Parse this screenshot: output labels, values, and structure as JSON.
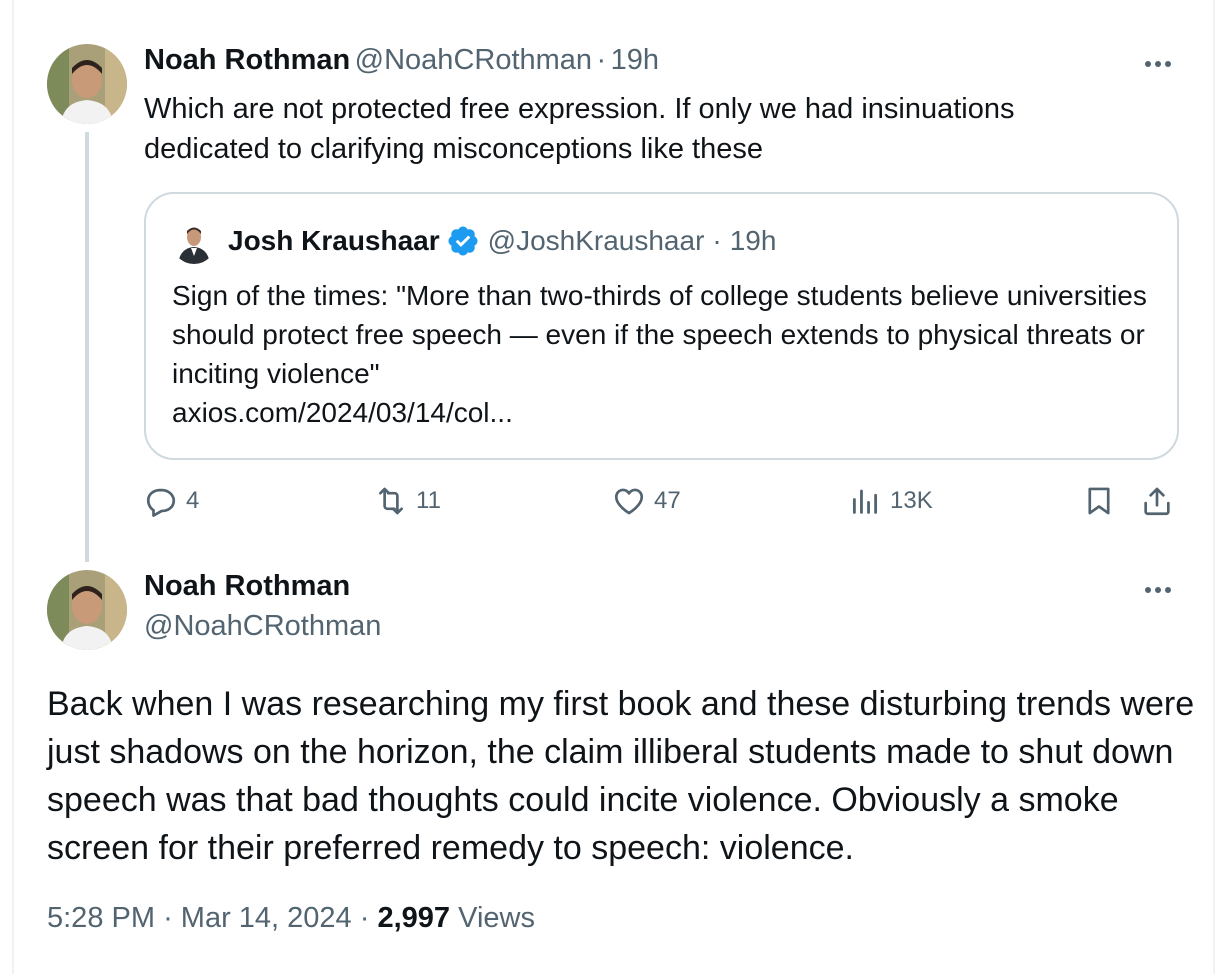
{
  "post1": {
    "author_name": "Noah Rothman",
    "author_handle": "@NoahCRothman",
    "separator": "·",
    "time": "19h",
    "text": "Which are not protected free expression. If only we had insinuations dedicated to clarifying misconceptions like these",
    "quote": {
      "author_name": "Josh Kraushaar",
      "author_handle": "@JoshKraushaar",
      "time": "19h",
      "text": "Sign of the times: \"More than two-thirds of college students believe universities should protect free speech — even if the speech extends to physical threats or inciting violence\"",
      "link": "axios.com/2024/03/14/col..."
    },
    "stats": {
      "replies": "4",
      "reposts": "11",
      "likes": "47",
      "views": "13K"
    }
  },
  "post2": {
    "author_name": "Noah Rothman",
    "author_handle": "@NoahCRothman",
    "text": "Back when I was researching my first book and these disturbing trends were just shadows on the horizon, the claim illiberal students made to shut down speech was that bad thoughts could incite violence. Obviously a smoke screen for their preferred remedy to speech: violence.",
    "time": "5:28 PM",
    "date": "Mar 14, 2024",
    "views_count": "2,997",
    "views_label": "Views"
  },
  "colors": {
    "text_primary": "#0f1419",
    "text_secondary": "#536471",
    "border": "#cfd9de",
    "verified": "#1d9bf0"
  },
  "icons": [
    "more-icon",
    "reply-icon",
    "repost-icon",
    "like-icon",
    "views-icon",
    "bookmark-icon",
    "share-icon",
    "verified-badge-icon"
  ]
}
